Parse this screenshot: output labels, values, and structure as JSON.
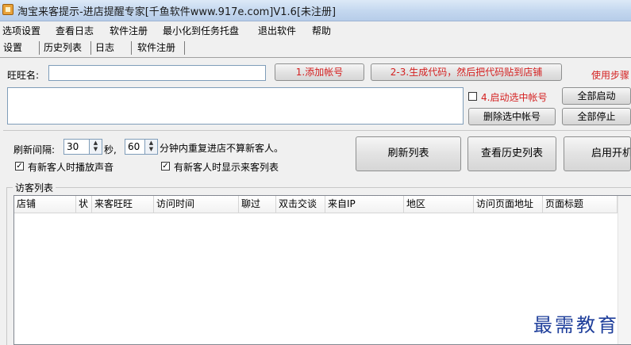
{
  "window": {
    "title": "淘宝来客提示-进店提醒专家[千鱼软件www.917e.com]V1.6[未注册]"
  },
  "menu": [
    "选项设置",
    "查看日志",
    "软件注册",
    "最小化到任务托盘",
    "退出软件",
    "帮助"
  ],
  "tabs": [
    "设置",
    "历史列表",
    "日志",
    "软件注册"
  ],
  "account": {
    "label": "旺旺名:",
    "value": "",
    "add_button": "1.添加帐号",
    "generate_button": "2-3.生成代码，然后把代码贴到店铺",
    "usage_steps": "使用步骤"
  },
  "account_actions": {
    "enable_selected_label": "4.启动选中帐号",
    "enable_selected_checked": false,
    "delete_selected": "删除选中帐号",
    "start_all": "全部启动",
    "stop_all": "全部停止"
  },
  "refresh": {
    "label": "刷新间隔:",
    "interval_value": "30",
    "seconds_unit": "秒,",
    "repeat_value": "60",
    "repeat_text": "分钟内重复进店不算新客人。",
    "sound_option": "有新客人时播放声音",
    "sound_checked": true,
    "show_option": "有新客人时显示来客列表",
    "show_checked": true,
    "refresh_button": "刷新列表",
    "history_button": "查看历史列表",
    "autostart_button": "启用开机"
  },
  "visitor_list": {
    "group_label": "访客列表",
    "columns": [
      "店铺",
      "状",
      "来客旺旺",
      "访问时间",
      "聊过",
      "双击交谈",
      "来自IP",
      "地区",
      "访问页面地址",
      "页面标题"
    ],
    "rows": []
  },
  "watermark": "最需教育",
  "colors": {
    "accent_red": "#d42020",
    "title_bar": "#c3d7ef",
    "watermark": "#1f3f9b"
  }
}
